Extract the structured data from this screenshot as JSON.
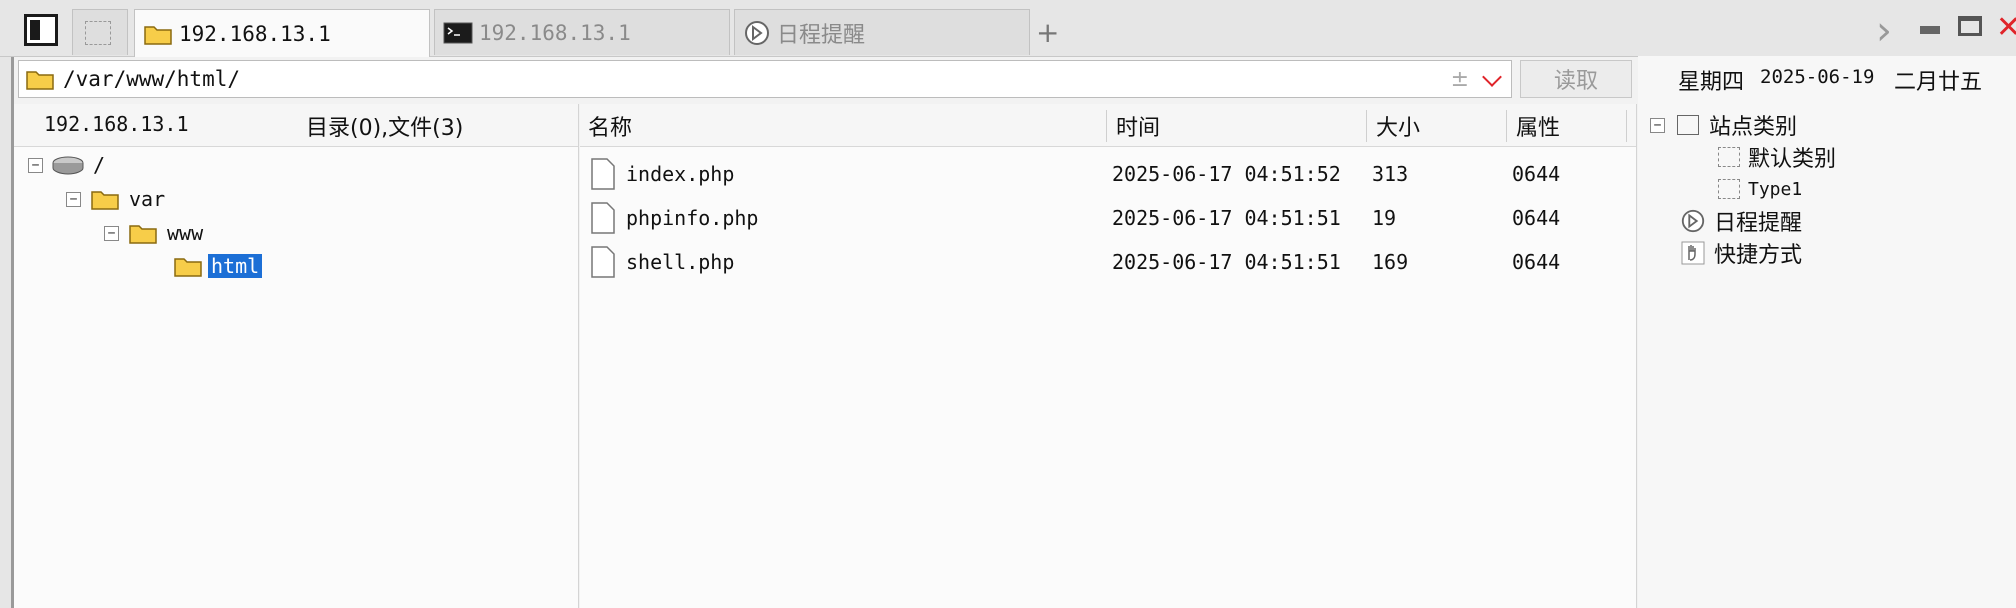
{
  "tabs": [
    {
      "label": "",
      "kind": "blank"
    },
    {
      "label": "192.168.13.1",
      "kind": "folder",
      "active": true
    },
    {
      "label": "192.168.13.1",
      "kind": "terminal",
      "active": false
    },
    {
      "label": "日程提醒",
      "kind": "schedule",
      "active": false
    }
  ],
  "add_tab_label": "+",
  "window_controls": {
    "next": "›",
    "minimize": "▬",
    "maximize": "☐",
    "close": "✕"
  },
  "address": {
    "path": "/var/www/html/",
    "plusminus": "±",
    "dropdown": "⌵"
  },
  "read_button": "读取",
  "left_header": {
    "host": "192.168.13.1",
    "summary": "目录(0),文件(3)"
  },
  "tree": [
    {
      "label": "/",
      "toggle": "⊟",
      "kind": "drive"
    },
    {
      "label": "var",
      "toggle": "⊟",
      "kind": "folder"
    },
    {
      "label": "www",
      "toggle": "⊟",
      "kind": "folder"
    },
    {
      "label": "html",
      "toggle": "",
      "kind": "folder",
      "selected": true
    }
  ],
  "columns": {
    "name": "名称",
    "time": "时间",
    "size": "大小",
    "attr": "属性"
  },
  "files": [
    {
      "name": "index.php",
      "time": "2025-06-17 04:51:52",
      "size": "313",
      "attr": "0644"
    },
    {
      "name": "phpinfo.php",
      "time": "2025-06-17 04:51:51",
      "size": "19",
      "attr": "0644"
    },
    {
      "name": "shell.php",
      "time": "2025-06-17 04:51:51",
      "size": "169",
      "attr": "0644"
    }
  ],
  "date_bar": {
    "weekday": "星期四",
    "date": "2025-06-19",
    "lunar": "二月廿五"
  },
  "site_tree": {
    "root": "站点类别",
    "root_toggle": "⊟",
    "children": [
      "默认类别",
      "Type1"
    ],
    "schedule": "日程提醒",
    "shortcuts": "快捷方式"
  },
  "colors": {
    "accent": "#1c6fd6",
    "close": "#e0242a",
    "folder": "#f5c02c"
  }
}
